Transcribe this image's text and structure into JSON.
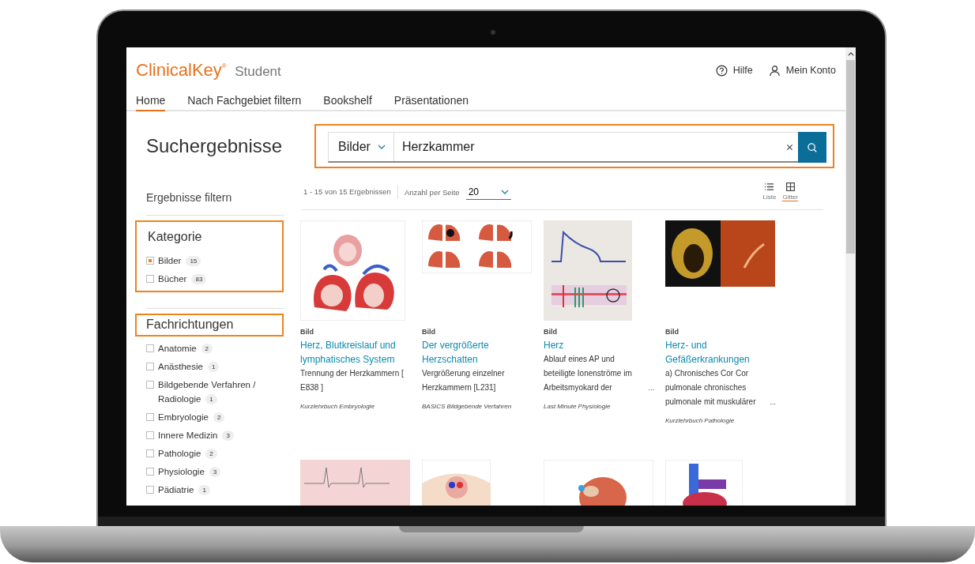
{
  "brand": {
    "name": "ClinicalKey",
    "mark": "®",
    "product": "Student"
  },
  "header_links": [
    {
      "label": "Hilfe",
      "kind": "help"
    },
    {
      "label": "Mein Konto",
      "kind": "account"
    }
  ],
  "nav_tabs": [
    {
      "label": "Home",
      "selected": true
    },
    {
      "label": "Nach Fachgebiet filtern",
      "selected": false
    },
    {
      "label": "Bookshelf",
      "selected": false
    },
    {
      "label": "Präsentationen",
      "selected": false
    }
  ],
  "page_title": "Suchergebnisse",
  "search": {
    "scope": "Bilder",
    "value": "Herzkammer",
    "highlighted": true
  },
  "filter_title": "Ergebnisse filtern",
  "filter_groups": [
    {
      "title": "Kategorie",
      "group_highlighted": true,
      "title_highlighted": false,
      "options": [
        {
          "label": "Bilder",
          "count": "15",
          "checked": true
        },
        {
          "label": "Bücher",
          "count": "83",
          "checked": false
        }
      ]
    },
    {
      "title": "Fachrichtungen",
      "group_highlighted": false,
      "title_highlighted": true,
      "options": [
        {
          "label": "Anatomie",
          "count": "2",
          "checked": false
        },
        {
          "label": "Anästhesie",
          "count": "1",
          "checked": false
        },
        {
          "label": "Bildgebende Verfahren / Radiologie",
          "count": "1",
          "checked": false
        },
        {
          "label": "Embryologie",
          "count": "2",
          "checked": false
        },
        {
          "label": "Innere Medizin",
          "count": "3",
          "checked": false
        },
        {
          "label": "Pathologie",
          "count": "2",
          "checked": false
        },
        {
          "label": "Physiologie",
          "count": "3",
          "checked": false
        },
        {
          "label": "Pädiatrie",
          "count": "1",
          "checked": false
        }
      ]
    }
  ],
  "results_summary": "1 - 15 von 15 Ergebnissen",
  "per_page": {
    "label": "Anzahl per Seite",
    "value": "20"
  },
  "view_toggle": [
    {
      "label": "Liste",
      "kind": "list",
      "selected": false
    },
    {
      "label": "Gitter",
      "kind": "grid",
      "selected": true
    }
  ],
  "results": [
    {
      "kind": "picture",
      "type": "Bild",
      "title": "Herz, Blutkreislauf und lymphatisches System",
      "description": "Trennung der Herzkammern [ E838 ]",
      "source": "Kurzlehrbuch Embryologie"
    },
    {
      "kind": "picture",
      "type": "Bild",
      "title": "Der vergrößerte Herzschatten",
      "description": "Vergrößerung einzelner Herzkammern [L231]",
      "source": "BASICS Bildgebende Verfahren"
    },
    {
      "kind": "picture",
      "type": "Bild",
      "title": "Herz",
      "description": "Ablauf eines AP und beteiligte Ionenströme im Arbeitsmyokard der",
      "more": "...",
      "source": "Last Minute Physiologie"
    },
    {
      "kind": "picture",
      "type": "Bild",
      "title": "Herz- und Gefäßerkrankungen",
      "description": "a) Chronisches Cor Cor pulmonale chronisches pulmonale mit muskulärer",
      "more": "...",
      "source": "Kurzlehrbuch Pathologie"
    },
    {
      "kind": "picture"
    },
    {
      "kind": "picture"
    },
    {
      "kind": "picture"
    },
    {
      "kind": "picture"
    }
  ]
}
